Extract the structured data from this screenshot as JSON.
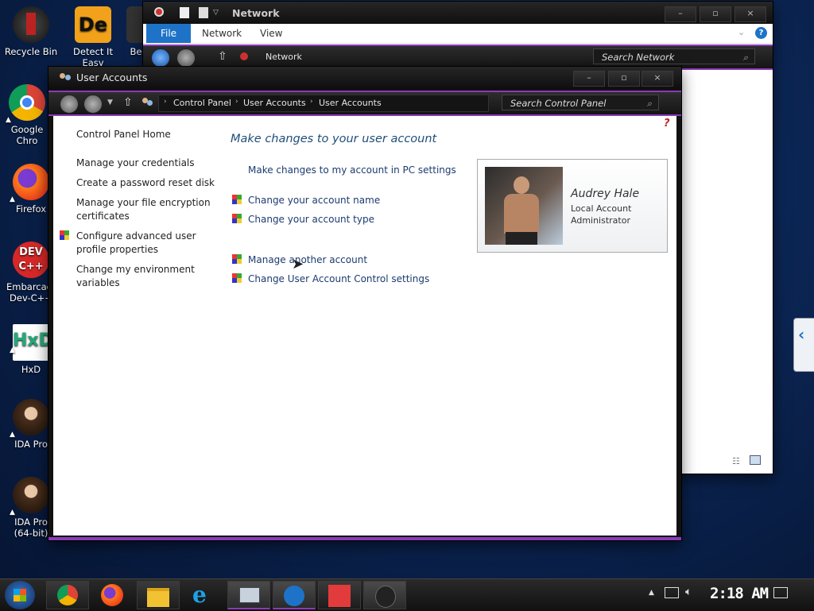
{
  "desktop": {
    "icons": [
      {
        "label": "Recycle Bin"
      },
      {
        "label": "Detect It Easy"
      },
      {
        "label": "Be"
      },
      {
        "label": "Google Chro"
      },
      {
        "label": "Firefox"
      },
      {
        "label": "Embarcade Dev-C++"
      },
      {
        "label": "HxD"
      },
      {
        "label": "IDA Pro"
      },
      {
        "label": "IDA Pro (64-bit)"
      }
    ]
  },
  "network_window": {
    "title": "Network",
    "ribbon_tabs": [
      "File",
      "Network",
      "View"
    ],
    "breadcrumb": "Network",
    "search_placeholder": "Search Network",
    "help_label": "?"
  },
  "user_accounts": {
    "title": "User Accounts",
    "breadcrumb": [
      "Control Panel",
      "User Accounts",
      "User Accounts"
    ],
    "search_placeholder": "Search Control Panel",
    "help_label": "?",
    "sidebar": {
      "home": "Control Panel Home",
      "items": [
        "Manage your credentials",
        "Create a password reset disk",
        "Manage your file encryption certificates",
        "Configure advanced user profile properties",
        "Change my environment variables"
      ]
    },
    "main": {
      "heading": "Make changes to your user account",
      "pc_settings_link": "Make changes to my account in PC settings",
      "links": [
        "Change your account name",
        "Change your account type",
        "Manage another account",
        "Change User Account Control settings"
      ]
    },
    "account": {
      "name": "Audrey Hale",
      "type": "Local Account",
      "role": "Administrator"
    }
  },
  "taskbar": {
    "clock": "2:18 AM"
  },
  "colors": {
    "accent": "#8a3bb8",
    "link": "#1b3b6f",
    "heading": "#1f4e79"
  }
}
